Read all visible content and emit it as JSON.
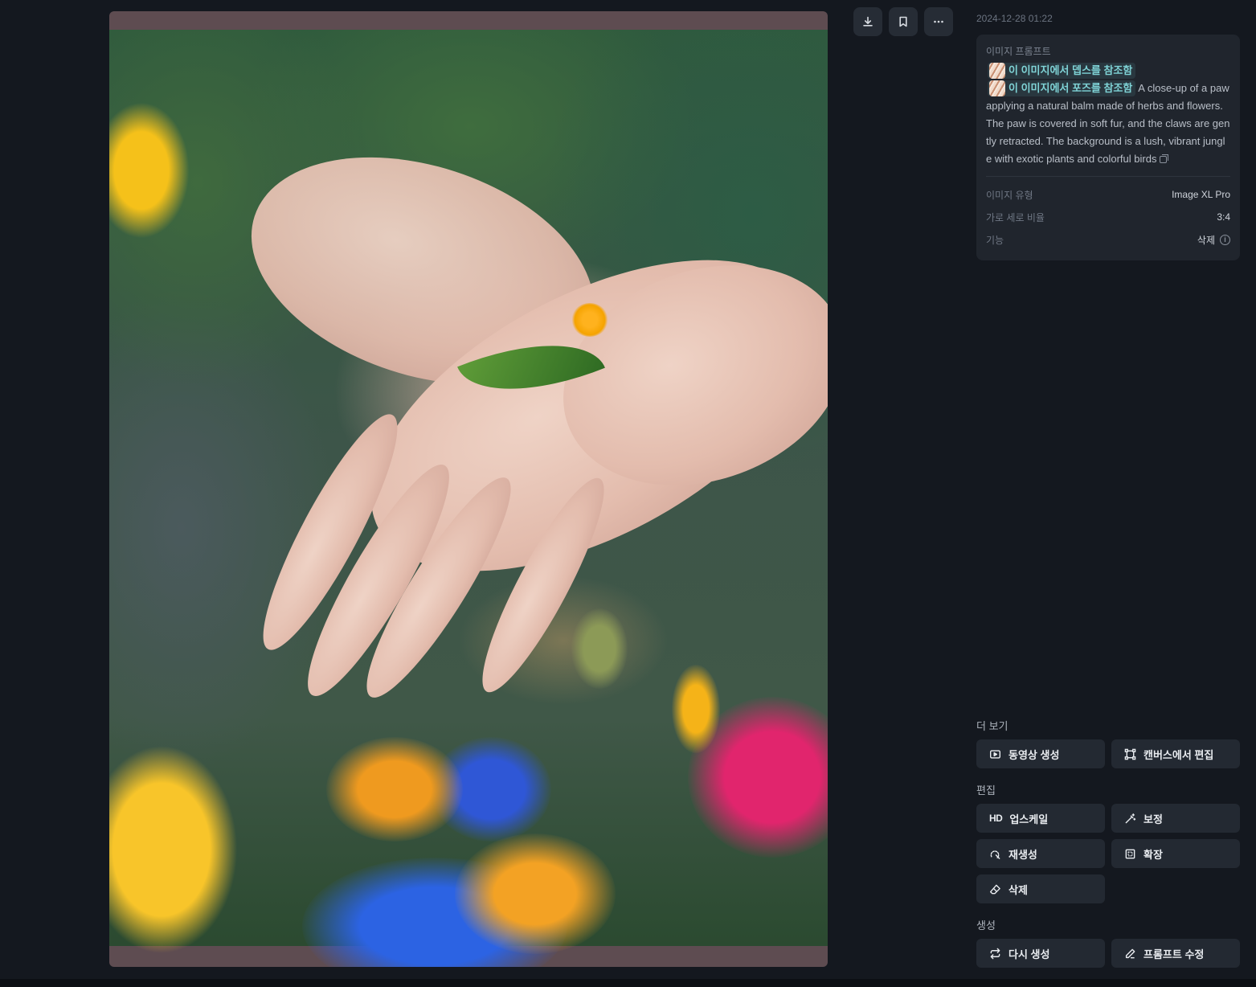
{
  "image": {
    "alt_icon": "photo-preview"
  },
  "actions": {
    "download": "download-icon",
    "bookmark": "bookmark-icon",
    "more": "more-icon"
  },
  "timestamp": "2024-12-28 01:22",
  "prompt_card": {
    "label": "이미지 프롬프트",
    "references": [
      "이 이미지에서 뎁스를 참조함",
      "이 이미지에서 포즈를 참조함"
    ],
    "prompt_text": "A close-up of a paw applying a natural balm made of herbs and flowers. The paw is covered in soft fur, and the claws are gently retracted. The background is a lush, vibrant jungle with exotic plants and colorful birds",
    "meta": [
      {
        "key": "이미지 유형",
        "value": "Image XL Pro"
      },
      {
        "key": "가로 세로 비율",
        "value": "3:4"
      },
      {
        "key": "기능",
        "value": "삭제"
      }
    ]
  },
  "sections": {
    "more": {
      "title": "더 보기",
      "buttons": [
        "동영상 생성",
        "캔버스에서 편집"
      ]
    },
    "edit": {
      "title": "편집",
      "hd_badge": "HD",
      "buttons": [
        "업스케일",
        "보정",
        "재생성",
        "확장",
        "삭제"
      ]
    },
    "generate": {
      "title": "생성",
      "buttons": [
        "다시 생성",
        "프롬프트 수정"
      ]
    }
  },
  "colors": {
    "background": "#14181f",
    "card": "#20252d",
    "button": "#232932",
    "accent": "#7fd3d6"
  }
}
